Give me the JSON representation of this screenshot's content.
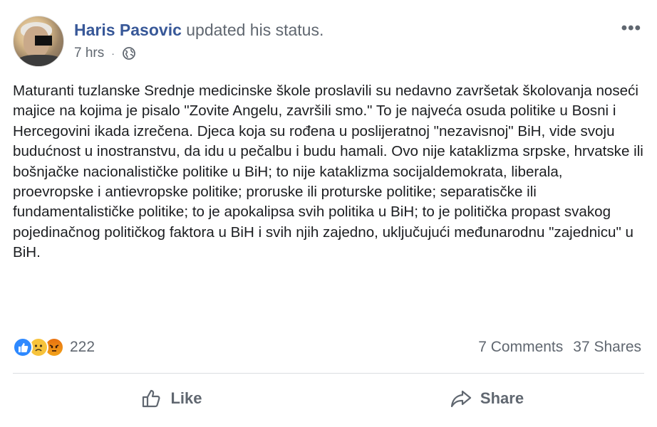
{
  "post": {
    "author": "Haris Pasovic",
    "action_text": "updated his status.",
    "time": "7 hrs",
    "time_separator": "·",
    "privacy_icon": "globe-icon",
    "more_label": "•••",
    "content": "Maturanti tuzlanske Srednje medicinske škole proslavili su nedavno završetak školovanja noseći majice na kojima je pisalo \"Zovite Angelu, završili smo.\" To je najveća osuda politike u Bosni i Hercegovini ikada izrečena. Djeca koja su rođena u poslijeratnoj \"nezavisnoj\" BiH, vide svoju budućnost u inostranstvu, da idu u pečalbu i budu hamali. Ovo nije kataklizma srpske, hrvatske ili bošnjačke nacionalističke politike u BiH; to nije kataklizma socijaldemokrata, liberala, proevropske i antievropske politike; proruske ili proturske politike; separatisčke ili fundamentalističke politike; to je apokalipsa svih politika u BiH; to je politička propast svakog pojedinačnog političkog faktora u BiH i svih njih zajedno, uključujući međunarodnu \"zajednicu\" u BiH."
  },
  "stats": {
    "reactions": [
      "like",
      "sad",
      "angry"
    ],
    "reaction_count": "222",
    "comments": "7 Comments",
    "shares": "37 Shares"
  },
  "actions": {
    "like_label": "Like",
    "share_label": "Share"
  },
  "colors": {
    "author": "#385898",
    "secondary_text": "#606770",
    "like_blue": "#2e89ff",
    "sad_yellow": "#f7c33b",
    "angry_orange": "#e9710f"
  }
}
